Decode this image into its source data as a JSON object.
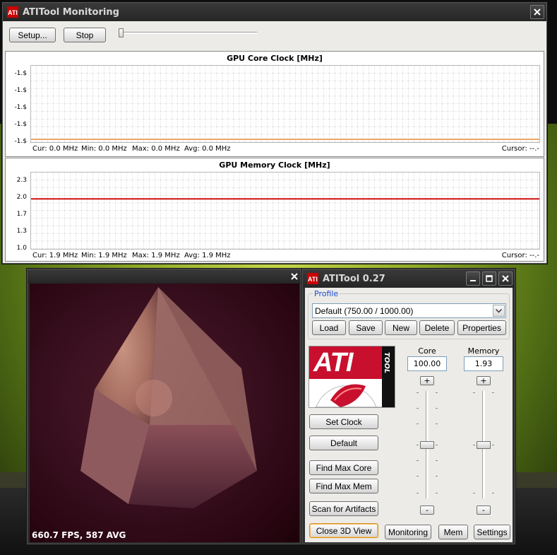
{
  "monitoring_window": {
    "title": "ATITool Monitoring",
    "setup_label": "Setup...",
    "stop_label": "Stop",
    "core_graph": {
      "title": "GPU Core Clock [MHz]",
      "yticks": [
        "-1.$",
        "-1.$",
        "-1.$",
        "-1.$",
        "-1.$"
      ],
      "cur": "Cur: 0.0 MHz",
      "min": "Min: 0.0 MHz",
      "max": "Max: 0.0 MHz",
      "avg": "Avg: 0.0 MHz",
      "cursor": "Cursor: --.-",
      "line_color": "#e8a060"
    },
    "mem_graph": {
      "title": "GPU Memory Clock [MHz]",
      "yticks": [
        "2.3",
        "2.0",
        "1.7",
        "1.3",
        "1.0"
      ],
      "cur": "Cur: 1.9 MHz",
      "min": "Min: 1.9 MHz",
      "max": "Max: 1.9 MHz",
      "avg": "Avg: 1.9 MHz",
      "cursor": "Cursor: --.-",
      "line_color": "#cc0000"
    }
  },
  "view3d_window": {
    "fps_label": "660.7 FPS, 587 AVG"
  },
  "atitool_window": {
    "title": "ATITool 0.27",
    "profile_label": "Profile",
    "profile_selected": "Default (750.00 / 1000.00)",
    "profile_buttons": {
      "load": "Load",
      "save": "Save",
      "new": "New",
      "delete": "Delete",
      "properties": "Properties"
    },
    "logo_text": "ATI",
    "logo_sub": "TOOL",
    "core_label": "Core",
    "memory_label": "Memory",
    "core_value": "100.00",
    "memory_value": "1.93",
    "plus": "+",
    "minus": "-",
    "buttons": {
      "set_clock": "Set Clock",
      "default": "Default",
      "find_max_core": "Find Max Core",
      "find_max_mem": "Find Max Mem",
      "scan_artifacts": "Scan for Artifacts",
      "close_3d": "Close 3D View",
      "monitoring": "Monitoring",
      "mem": "Mem",
      "settings": "Settings"
    }
  },
  "colors": {
    "accent_red": "#cc0000",
    "group_label_blue": "#1a4bd0",
    "focus_orange": "#d8901e"
  }
}
